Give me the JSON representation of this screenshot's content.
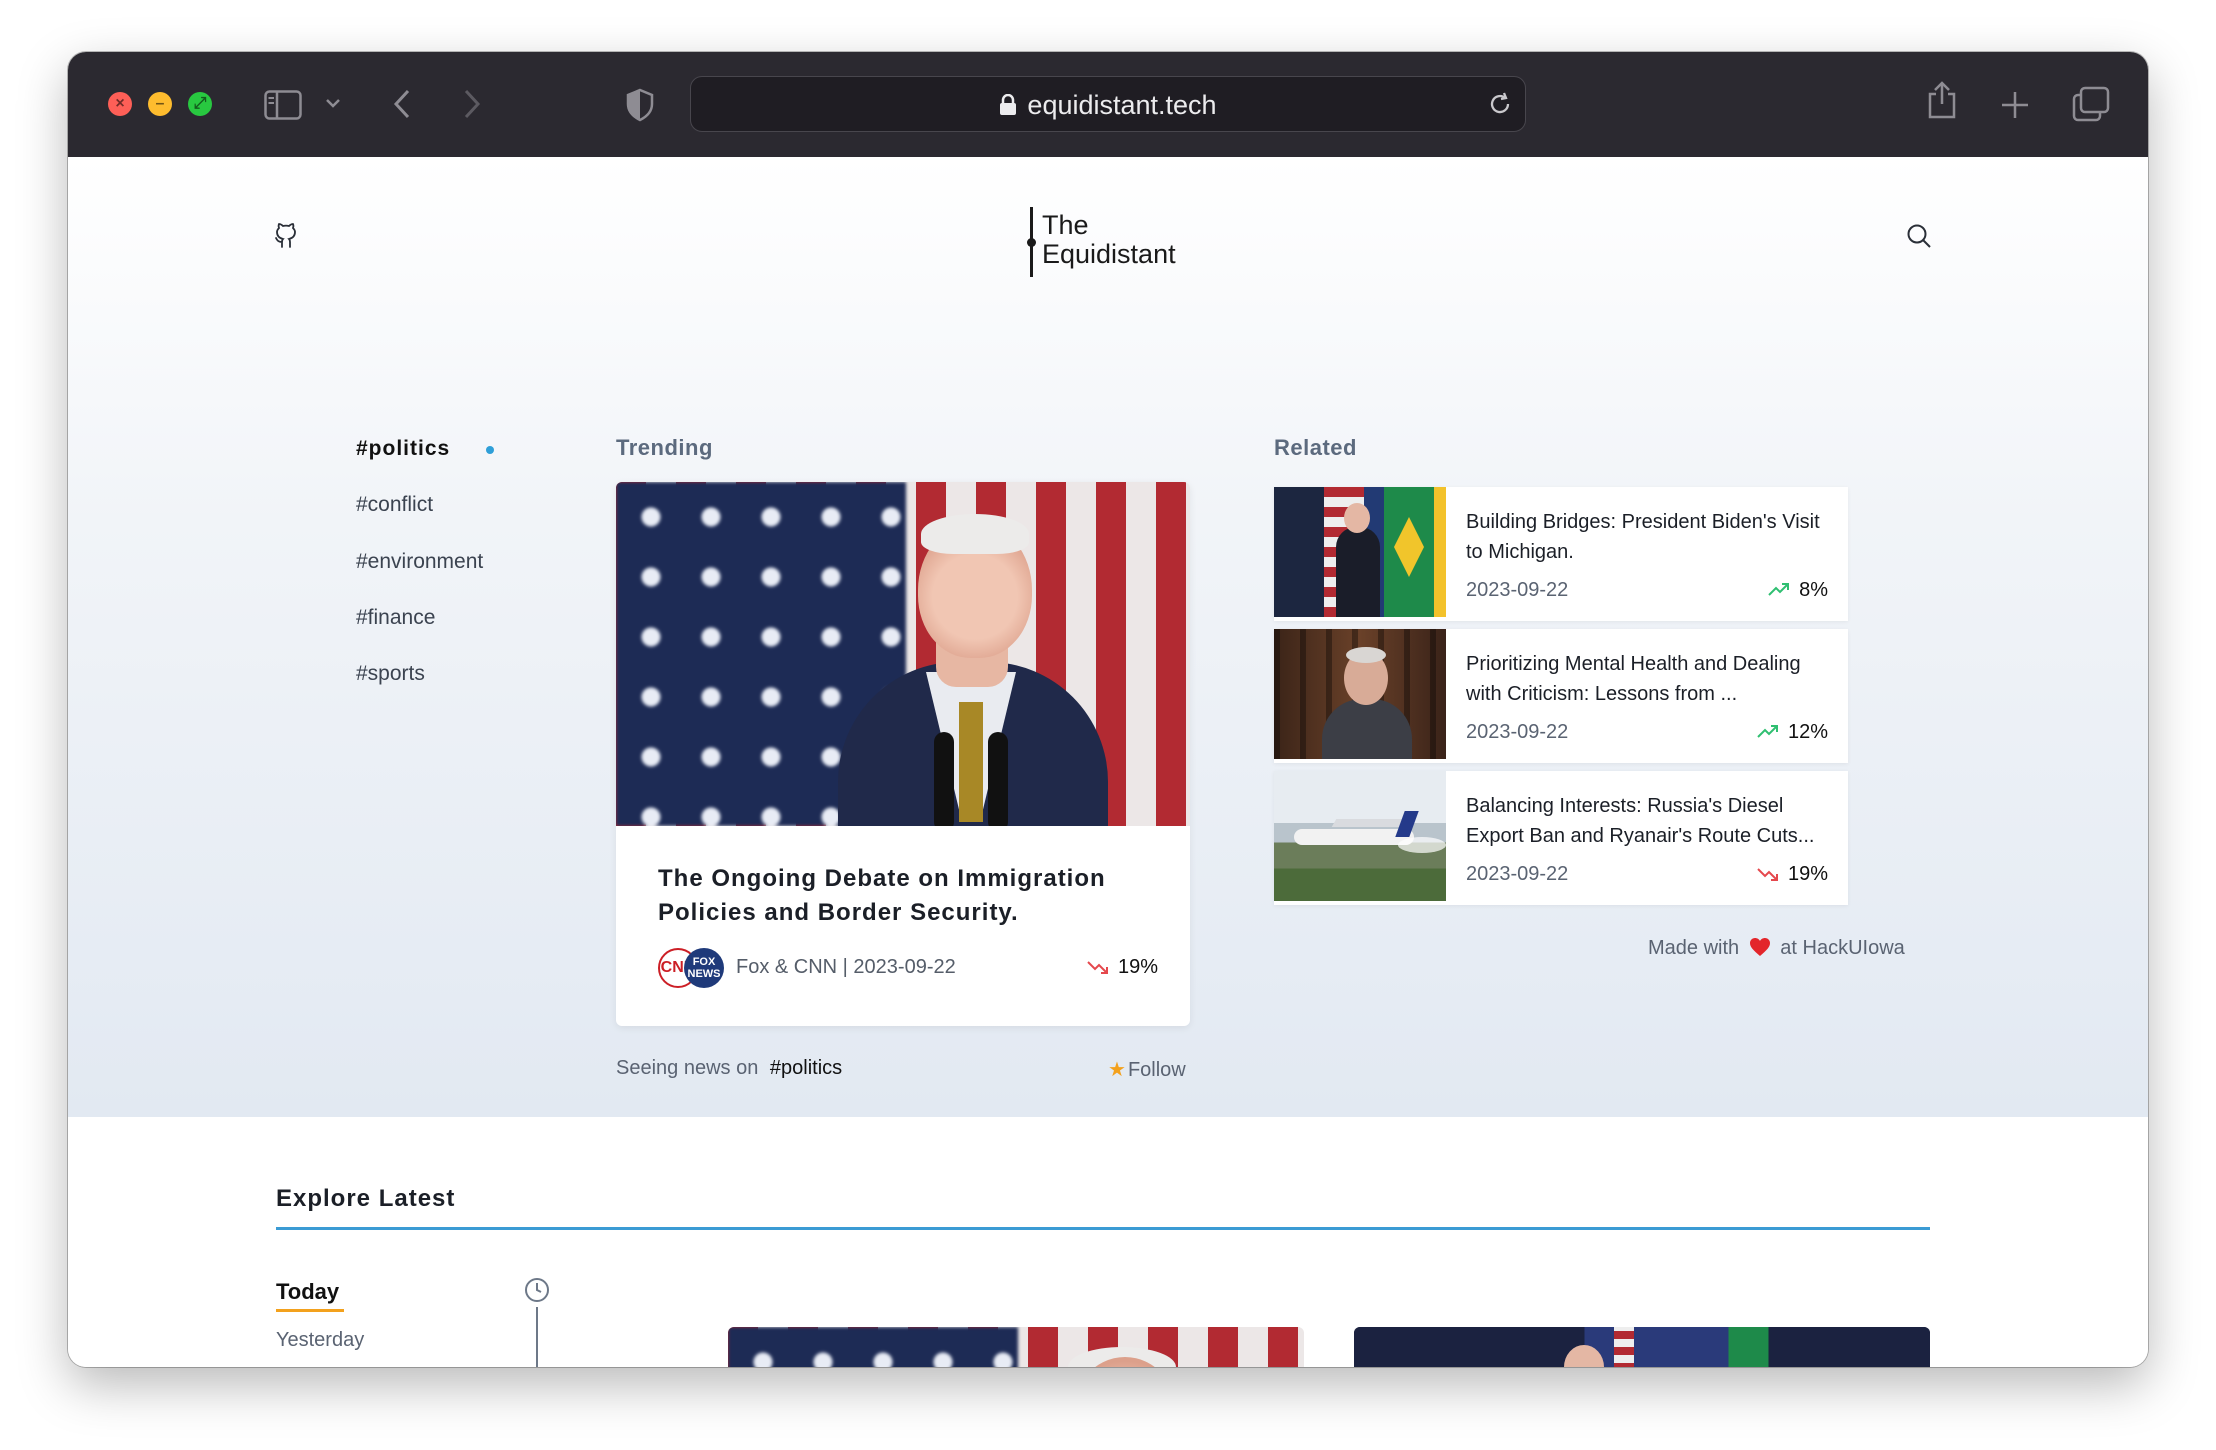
{
  "browser": {
    "url": "equidistant.tech"
  },
  "site": {
    "logo_line1": "The",
    "logo_line2": "Equidistant"
  },
  "tags": {
    "items": [
      "#politics",
      "#conflict",
      "#environment",
      "#finance",
      "#sports"
    ],
    "active": "#politics"
  },
  "trending": {
    "label": "Trending",
    "title": "The Ongoing Debate on Immigration Policies and Border Security.",
    "source": "Fox & CNN | 2023-09-22",
    "source_logo_left": "CNN",
    "source_logo_right": "FOX NEWS",
    "percent": "19%",
    "trend": "down"
  },
  "feed": {
    "seeing_prefix": "Seeing news on",
    "seeing_tag": "#politics",
    "follow_label": "Follow"
  },
  "related": {
    "label": "Related",
    "items": [
      {
        "title": "Building Bridges: President Biden's Visit to Michigan.",
        "date": "2023-09-22",
        "percent": "8%",
        "trend": "up"
      },
      {
        "title": "Prioritizing Mental Health and Dealing with Criticism: Lessons from ...",
        "date": "2023-09-22",
        "percent": "12%",
        "trend": "up"
      },
      {
        "title": "Balancing Interests: Russia's Diesel Export Ban and Ryanair's Route Cuts...",
        "date": "2023-09-22",
        "percent": "19%",
        "trend": "down"
      }
    ]
  },
  "footer_note": {
    "prefix": "Made with",
    "suffix": "at HackUIowa"
  },
  "explore": {
    "title": "Explore Latest",
    "days": [
      "Today",
      "Yesterday"
    ]
  },
  "colors": {
    "accent_blue": "#3b9bd4",
    "accent_orange": "#f3a11d",
    "trend_up": "#2fbf71",
    "trend_down": "#e5484d",
    "chrome_bg": "#2b2930"
  }
}
